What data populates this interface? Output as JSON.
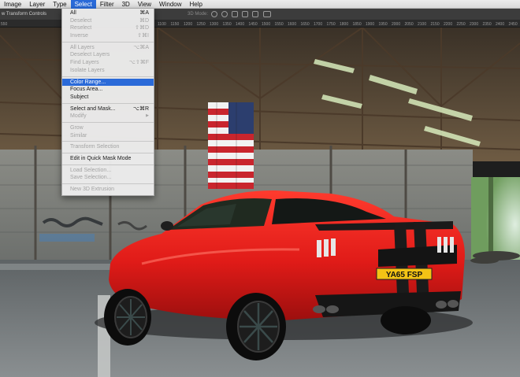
{
  "menubar": {
    "items": [
      {
        "label": "Image"
      },
      {
        "label": "Layer"
      },
      {
        "label": "Type"
      },
      {
        "label": "Select",
        "active": true
      },
      {
        "label": "Filter"
      },
      {
        "label": "3D"
      },
      {
        "label": "View"
      },
      {
        "label": "Window"
      },
      {
        "label": "Help"
      }
    ]
  },
  "options_bar": {
    "transform_controls_label": "w Transform Controls",
    "mode_label": "3D Mode:",
    "tools": [
      "3d-rotate-icon",
      "3d-roll-icon",
      "3d-pan-icon",
      "3d-slide-icon",
      "3d-scale-icon",
      "video-icon"
    ]
  },
  "ruler": {
    "ticks": [
      "550",
      "1100",
      "1150",
      "1200",
      "1250",
      "1300",
      "1350",
      "1400",
      "1450",
      "1500",
      "1550",
      "1600",
      "1650",
      "1700",
      "1750",
      "1800",
      "1850",
      "1900",
      "1950",
      "2000",
      "2050",
      "2100",
      "2150",
      "2200",
      "2250",
      "2300",
      "2350",
      "2400",
      "2450"
    ]
  },
  "select_menu": {
    "groups": [
      [
        {
          "label": "All",
          "shortcut": "⌘A",
          "enabled": true
        },
        {
          "label": "Deselect",
          "shortcut": "⌘D",
          "enabled": false
        },
        {
          "label": "Reselect",
          "shortcut": "⇧⌘D",
          "enabled": false
        },
        {
          "label": "Inverse",
          "shortcut": "⇧⌘I",
          "enabled": false
        }
      ],
      [
        {
          "label": "All Layers",
          "shortcut": "⌥⌘A",
          "enabled": false
        },
        {
          "label": "Deselect Layers",
          "shortcut": "",
          "enabled": false
        },
        {
          "label": "Find Layers",
          "shortcut": "⌥⇧⌘F",
          "enabled": false
        },
        {
          "label": "Isolate Layers",
          "shortcut": "",
          "enabled": false
        }
      ],
      [
        {
          "label": "Color Range...",
          "shortcut": "",
          "enabled": true,
          "highlighted": true
        },
        {
          "label": "Focus Area...",
          "shortcut": "",
          "enabled": true
        },
        {
          "label": "Subject",
          "shortcut": "",
          "enabled": true
        }
      ],
      [
        {
          "label": "Select and Mask...",
          "shortcut": "⌥⌘R",
          "enabled": true
        },
        {
          "label": "Modify",
          "shortcut": "",
          "enabled": false,
          "submenu": true
        }
      ],
      [
        {
          "label": "Grow",
          "shortcut": "",
          "enabled": false
        },
        {
          "label": "Similar",
          "shortcut": "",
          "enabled": false
        }
      ],
      [
        {
          "label": "Transform Selection",
          "shortcut": "",
          "enabled": false
        }
      ],
      [
        {
          "label": "Edit in Quick Mask Mode",
          "shortcut": "",
          "enabled": true
        }
      ],
      [
        {
          "label": "Load Selection...",
          "shortcut": "",
          "enabled": false
        },
        {
          "label": "Save Selection...",
          "shortcut": "",
          "enabled": false
        }
      ],
      [
        {
          "label": "New 3D Extrusion",
          "shortcut": "",
          "enabled": false
        }
      ]
    ]
  },
  "photo": {
    "license_plate": "YA65 FSP",
    "car_color": "#e8201e"
  },
  "colors": {
    "accent": "#2a6ad8"
  }
}
